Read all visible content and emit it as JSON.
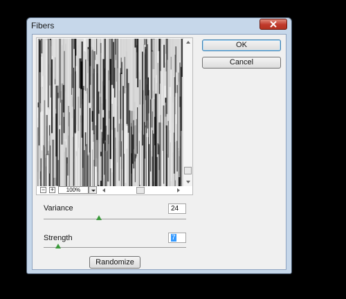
{
  "window": {
    "title": "Fibers"
  },
  "buttons": {
    "ok": "OK",
    "cancel": "Cancel",
    "randomize": "Randomize"
  },
  "preview": {
    "zoom": "100%"
  },
  "params": [
    {
      "label": "Variance",
      "value": "24",
      "slider": 0.39
    },
    {
      "label": "Strength",
      "value": "7",
      "slider": 0.1
    }
  ],
  "colors": {
    "ok_border": "#3c7fb1",
    "slider_thumb": "#3a9a3a",
    "close": "#c0392b"
  }
}
